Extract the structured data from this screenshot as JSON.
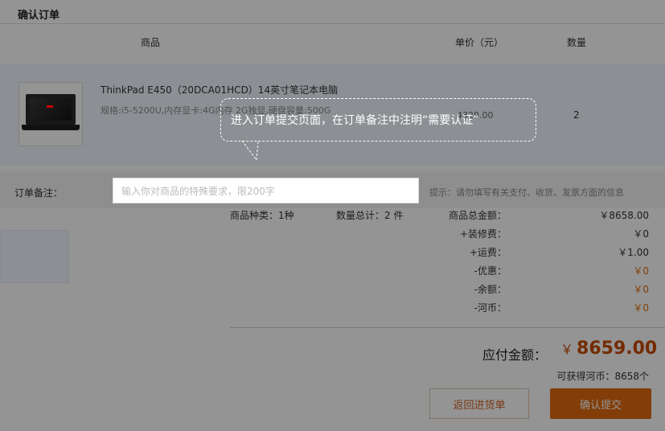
{
  "section": {
    "title": "确认订单"
  },
  "table_header": {
    "product": "商品",
    "unit_price": "单价（元）",
    "quantity": "数量"
  },
  "product": {
    "name": "ThinkPad E450（20DCA01HCD）14英寸笔记本电脑",
    "spec": "规格:i5-5200U,内存显卡:4G内存 2G独显,硬盘容量:500G",
    "price": "4329.00",
    "quantity": "2"
  },
  "note": {
    "label": "订单备注：",
    "placeholder": "输入你对商品的特殊要求，限200字",
    "hint": "提示：请勿填写有关支付、收货、发票方面的信息"
  },
  "summary": {
    "kinds": "商品种类：1种",
    "total_qty": "数量总计：2 件",
    "rows": [
      {
        "label": "商品总金额：",
        "value": "￥8658.00",
        "color": "#333333"
      },
      {
        "label": "+装修费：",
        "value": "￥0",
        "color": "#333333"
      },
      {
        "label": "+运费：",
        "value": "￥1.00",
        "color": "#333333"
      },
      {
        "label": "-优惠：",
        "value": "￥0",
        "color": "#e36c09"
      },
      {
        "label": "-余额：",
        "value": "￥0",
        "color": "#e36c09"
      },
      {
        "label": "-河币：",
        "value": "￥0",
        "color": "#e36c09"
      }
    ]
  },
  "payment": {
    "label": "应付金额：",
    "currency": "￥",
    "amount": "8659.00"
  },
  "earn": "可获得河币：8658个",
  "buttons": {
    "back": "返回进货单",
    "confirm": "确认提交"
  },
  "guide": {
    "text": "进入订单提交页面，在订单备注中注明“需要认证”"
  }
}
